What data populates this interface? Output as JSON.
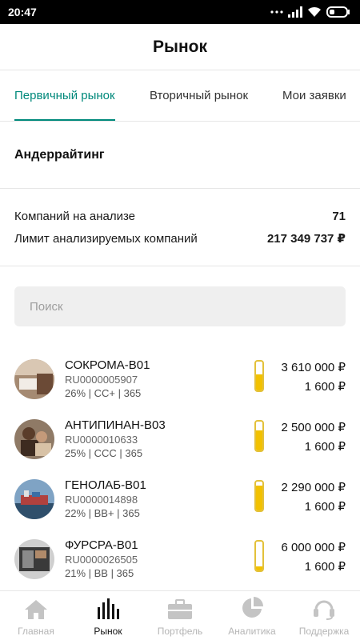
{
  "status_bar": {
    "time": "20:47"
  },
  "header": {
    "title": "Рынок"
  },
  "tabs": [
    {
      "label": "Первичный рынок",
      "active": true
    },
    {
      "label": "Вторичный рынок",
      "active": false
    },
    {
      "label": "Мои заявки",
      "active": false
    }
  ],
  "section": {
    "title": "Андеррайтинг"
  },
  "stats": [
    {
      "label": "Компаний на анализе",
      "value": "71"
    },
    {
      "label": "Лимит анализируемых компаний",
      "value": "217 349 737 ₽"
    }
  ],
  "search": {
    "placeholder": "Поиск"
  },
  "bonds": [
    {
      "name": "СОКРОМА-B01",
      "isin": "RU0000005907",
      "meta": "26% | CC+ | 365",
      "total": "3 610 000 ₽",
      "price": "1 600 ₽",
      "fill": 0.55,
      "avatar_color": "#8b6a55"
    },
    {
      "name": "АНТИПИНАН-B03",
      "isin": "RU0000010633",
      "meta": "25% | CCC | 365",
      "total": "2 500 000 ₽",
      "price": "1 600 ₽",
      "fill": 0.7,
      "avatar_color": "#6b5240"
    },
    {
      "name": "ГЕНОЛАБ-B01",
      "isin": "RU0000014898",
      "meta": "22% | BB+ | 365",
      "total": "2 290 000 ₽",
      "price": "1 600 ₽",
      "fill": 0.85,
      "avatar_color": "#3e5d77"
    },
    {
      "name": "ФУРСРА-B01",
      "isin": "RU0000026505",
      "meta": "21% | BB | 365",
      "total": "6 000 000 ₽",
      "price": "1 600 ₽",
      "fill": 0.15,
      "avatar_color": "#4a4a4a"
    }
  ],
  "bottom_nav": [
    {
      "label": "Главная",
      "icon": "home-icon",
      "active": false
    },
    {
      "label": "Рынок",
      "icon": "market-bars-icon",
      "active": true
    },
    {
      "label": "Портфель",
      "icon": "briefcase-icon",
      "active": false
    },
    {
      "label": "Аналитика",
      "icon": "pie-chart-icon",
      "active": false
    },
    {
      "label": "Поддержка",
      "icon": "headset-icon",
      "active": false
    }
  ],
  "colors": {
    "accent": "#00897b",
    "gauge": "#f2c100",
    "inactive_nav": "#b5b5b5"
  }
}
